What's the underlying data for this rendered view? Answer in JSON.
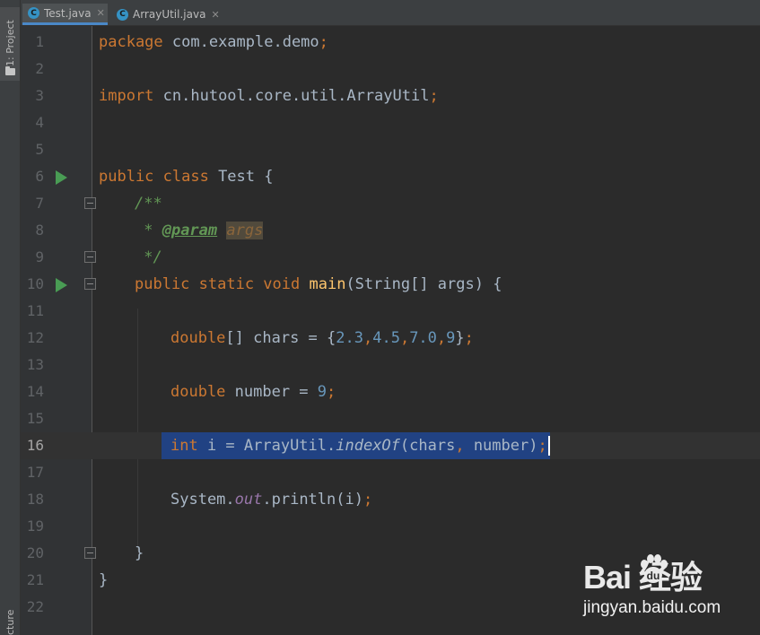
{
  "tool_windows": {
    "project_label": "1: Project",
    "structure_label": "cture"
  },
  "tabs": [
    {
      "label": "Test.java",
      "icon": "java-class-icon",
      "icon_glyph": "C",
      "active": true
    },
    {
      "label": "ArrayUtil.java",
      "icon": "java-class-icon",
      "icon_glyph": "C",
      "active": false
    }
  ],
  "tab_close_glyph": "✕",
  "editor": {
    "current_line": 16,
    "line_numbers": [
      "1",
      "2",
      "3",
      "4",
      "5",
      "6",
      "7",
      "8",
      "9",
      "10",
      "11",
      "12",
      "13",
      "14",
      "15",
      "16",
      "17",
      "18",
      "19",
      "20",
      "21",
      "22"
    ],
    "lines": {
      "l1": {
        "kw": "package",
        "rest": " com.example.demo",
        "semi": ";"
      },
      "l3": {
        "kw": "import",
        "rest": " cn.hutool.core.util.ArrayUtil",
        "semi": ";"
      },
      "l6": {
        "kw": "public class",
        "rest": " Test {"
      },
      "l7": {
        "doc": "/**"
      },
      "l8": {
        "doc": " * ",
        "tag": "@param",
        "sp": " ",
        "arg": "args"
      },
      "l9": {
        "doc": " */"
      },
      "l10": {
        "kw": "public static void",
        "sp": " ",
        "fn": "main",
        "rest": "(String[] args) {"
      },
      "l12": {
        "kw": "double",
        "rest": "[] chars = {",
        "n1": "2.3",
        "c1": ",",
        "n2": "4.5",
        "c2": ",",
        "n3": "7.0",
        "c3": ",",
        "n4": "9",
        "close": "}",
        "semi": ";"
      },
      "l14": {
        "kw": "double",
        "rest": " number = ",
        "num": "9",
        "semi": ";"
      },
      "l16": {
        "kw": "int",
        "rest": " i = ArrayUtil.",
        "method": "indexOf",
        "args": "(chars",
        "comma": ",",
        "args2": " number)",
        "semi": ";"
      },
      "l18": {
        "pre": "System.",
        "field": "out",
        "rest": ".println(i)",
        "semi": ";"
      },
      "l20": {
        "rest": "}"
      },
      "l21": {
        "rest": "}"
      }
    }
  },
  "colors": {
    "keyword": "#cc7832",
    "number": "#6897bb",
    "doc_comment": "#629755",
    "method_decl": "#ffc66d",
    "static_field": "#9876aa",
    "default_text": "#a9b7c6",
    "selection": "#214283",
    "run_icon": "#499c54",
    "background": "#2b2b2b"
  },
  "watermark": {
    "logo": "Bai  经验",
    "url": "jingyan.baidu.com"
  }
}
